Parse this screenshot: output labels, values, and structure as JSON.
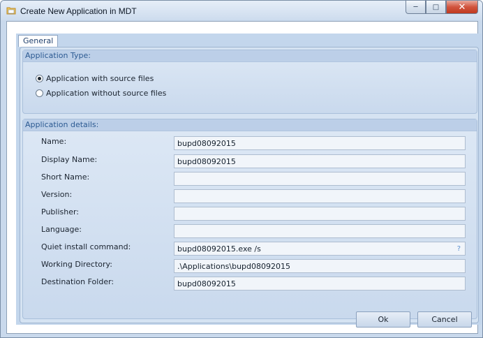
{
  "window": {
    "title": "Create New Application in MDT",
    "icon": "folder-app-icon",
    "controls": {
      "minimize": "minimize-icon",
      "maximize": "maximize-icon",
      "close": "close-icon"
    }
  },
  "tabs": [
    {
      "label": "General",
      "selected": true
    }
  ],
  "application_type": {
    "header": "Application Type:",
    "options": [
      {
        "label": "Application with source files",
        "selected": true
      },
      {
        "label": "Application without source files",
        "selected": false
      }
    ]
  },
  "application_details": {
    "header": "Application details:",
    "fields": [
      {
        "label": "Name:",
        "value": "bupd08092015"
      },
      {
        "label": "Display Name:",
        "value": "bupd08092015"
      },
      {
        "label": "Short Name:",
        "value": ""
      },
      {
        "label": "Version:",
        "value": ""
      },
      {
        "label": "Publisher:",
        "value": ""
      },
      {
        "label": "Language:",
        "value": ""
      },
      {
        "label": "Quiet install command:",
        "value": "bupd08092015.exe /s",
        "help": "?"
      },
      {
        "label": "Working Directory:",
        "value": ".\\Applications\\bupd08092015"
      },
      {
        "label": "Destination Folder:",
        "value": "bupd08092015"
      }
    ]
  },
  "buttons": {
    "ok": "Ok",
    "cancel": "Cancel"
  }
}
